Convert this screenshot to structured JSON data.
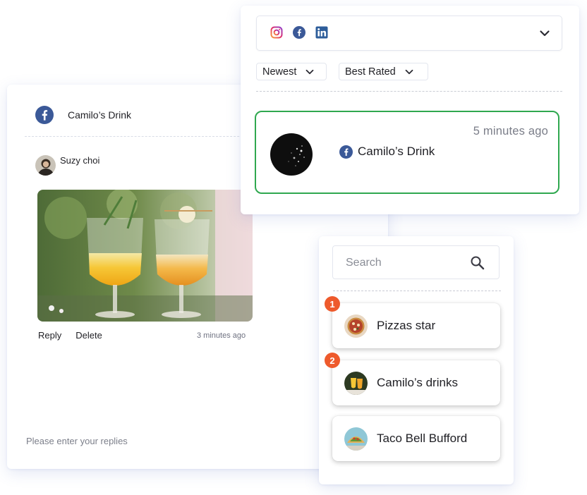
{
  "comment_panel": {
    "page_name": "Camilo’s Drink",
    "comment": {
      "author": "Suzy choi",
      "time_ago": "3 minutes ago",
      "actions": {
        "reply": "Reply",
        "delete": "Delete"
      }
    },
    "reply_placeholder": "Please enter your replies",
    "icons": {
      "page_icon": "facebook-icon",
      "author_avatar": "user-avatar",
      "photo": "cocktail-photo"
    }
  },
  "feed_panel": {
    "platforms": [
      "instagram-icon",
      "facebook-icon",
      "linkedin-icon"
    ],
    "filters": {
      "sort": "Newest",
      "rating": "Best Rated"
    },
    "selected_item": {
      "time_ago": "5 minutes ago",
      "name": "Camilo’s Drink",
      "platform_icon": "facebook-icon"
    },
    "colors": {
      "selected_border": "#2fa84f"
    }
  },
  "search_panel": {
    "placeholder": "Search",
    "items": [
      {
        "badge": "1",
        "label": "Pizzas star"
      },
      {
        "badge": "2",
        "label": "Camilo’s drinks"
      },
      {
        "badge": "",
        "label": "Taco Bell Bufford"
      }
    ],
    "colors": {
      "badge": "#ee5a2c"
    }
  }
}
